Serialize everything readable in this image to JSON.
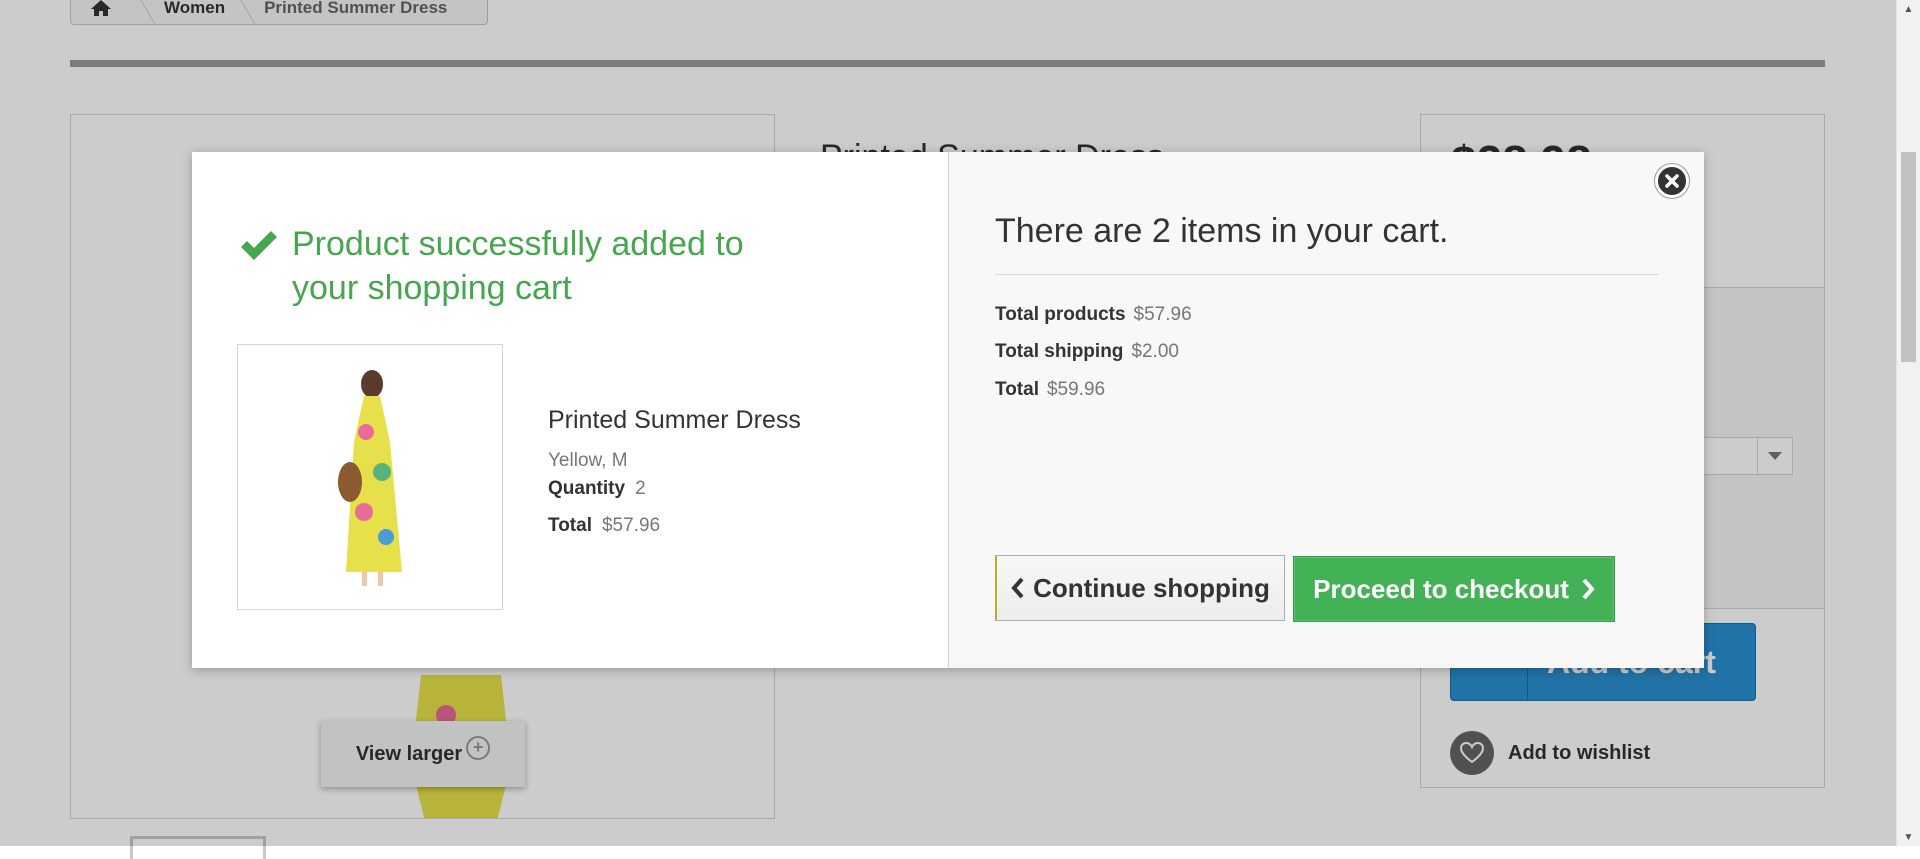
{
  "breadcrumb": {
    "home_icon": "home-icon",
    "items": [
      "Women",
      "Printed Summer Dress"
    ]
  },
  "product_page": {
    "title": "Printed Summer Dress",
    "price": "$28.98",
    "view_larger": "View larger",
    "add_to_cart": "Add to cart",
    "wishlist": "Add to wishlist"
  },
  "modal": {
    "success_message": "Product successfully added to your shopping cart",
    "product": {
      "name": "Printed Summer Dress",
      "attributes": "Yellow, M",
      "quantity_label": "Quantity",
      "quantity_value": "2",
      "total_label": "Total",
      "total_value": "$57.96"
    },
    "cart_summary": {
      "heading": "There are 2 items in your cart.",
      "total_products_label": "Total products",
      "total_products_value": "$57.96",
      "total_shipping_label": "Total shipping",
      "total_shipping_value": "$2.00",
      "total_label": "Total",
      "total_value": "$59.96"
    },
    "continue_label": "Continue shopping",
    "checkout_label": "Proceed to checkout"
  },
  "colors": {
    "success": "#46a74e",
    "checkout": "#43b155",
    "cart_button": "#2a8fd0"
  }
}
